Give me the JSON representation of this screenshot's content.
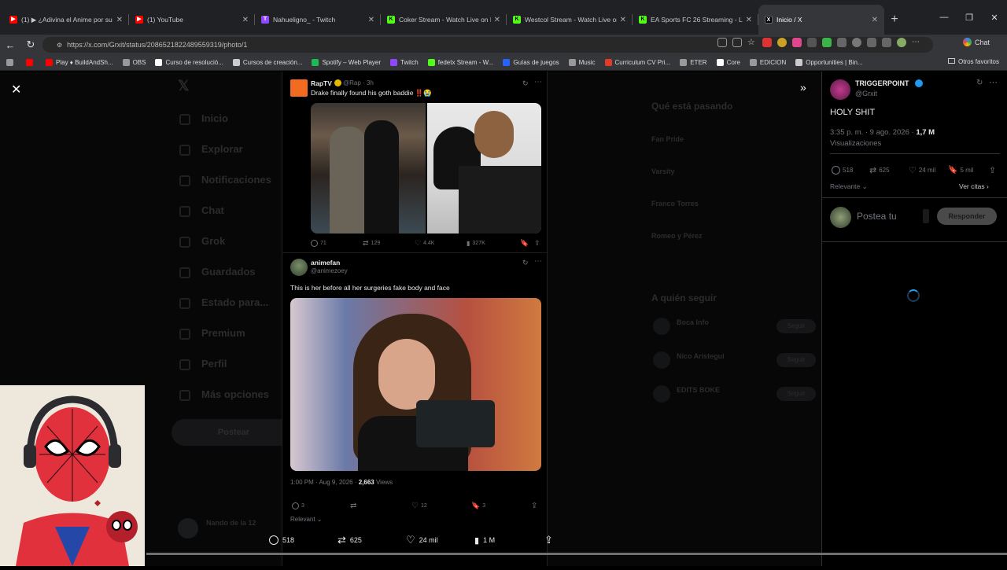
{
  "browser": {
    "tabs": [
      {
        "title": "(1) ▶ ¿Adivina el Anime por su Et",
        "fav": "▶",
        "color": "#ff0000"
      },
      {
        "title": "(1) YouTube",
        "fav": "▶",
        "color": "#ff0000"
      },
      {
        "title": "Nahueligno_ - Twitch",
        "fav": "T",
        "color": "#9146ff"
      },
      {
        "title": "Coker Stream - Watch Live on K",
        "fav": "K",
        "color": "#53fc18"
      },
      {
        "title": "Westcol Stream - Watch Live on K",
        "fav": "K",
        "color": "#53fc18"
      },
      {
        "title": "EA Sports FC 26 Streaming - Live S",
        "fav": "K",
        "color": "#53fc18"
      },
      {
        "title": "Inicio / X",
        "fav": "X",
        "color": "#000000"
      }
    ],
    "url": "https://x.com/Grxit/status/2086521822489559319/photo/1",
    "chat_label": "Chat",
    "bookmarks": [
      {
        "label": "",
        "color": "#999999"
      },
      {
        "label": "",
        "color": "#ff0000"
      },
      {
        "label": "Play ♦ BuildAndSh...",
        "color": "#ff0000"
      },
      {
        "label": "OBS",
        "color": "#999999"
      },
      {
        "label": "Curso de resolució...",
        "color": "#ffffff"
      },
      {
        "label": "Cursos de creación...",
        "color": "#cccccc"
      },
      {
        "label": "Spotify – Web Player",
        "color": "#1db954"
      },
      {
        "label": "Twitch",
        "color": "#9146ff"
      },
      {
        "label": "fedetx Stream - W...",
        "color": "#53fc18"
      },
      {
        "label": "Guías de juegos",
        "color": "#2962ff"
      },
      {
        "label": "Music",
        "color": "#999999"
      },
      {
        "label": "Curriculum CV Pri...",
        "color": "#e03b2b"
      },
      {
        "label": "ETER",
        "color": "#999999"
      },
      {
        "label": "Core",
        "color": "#ffffff"
      },
      {
        "label": "EDICION",
        "color": "#999999"
      },
      {
        "label": "Opportunities | Bin...",
        "color": "#cccccc"
      }
    ],
    "other_bookmarks": "Otros favoritos"
  },
  "background_nav": [
    "Inicio",
    "Explorar",
    "Notificaciones",
    "Chat",
    "Grok",
    "Guardados",
    "Estado para...",
    "Premium",
    "Perfil",
    "Más opciones"
  ],
  "background_post_button": "Postear",
  "background_right": {
    "heading": "Qué está pasando",
    "items": [
      "Fan Pride",
      "Varsity",
      "Franco Torres",
      "Romeo y Pérez"
    ],
    "who_to_follow": "A quién seguir",
    "follow": [
      "Boca Info",
      "Nico Arístegui",
      "EDITS BOKE"
    ],
    "follow_btn": "Seguir"
  },
  "background_user": "Nando de la 12",
  "post1": {
    "name": "RapTV",
    "handle": "@Rap · 3h",
    "text": "Drake finally found his goth baddie ‼️😭",
    "replies": "71",
    "reposts": "129",
    "likes": "4.4K",
    "views": "327K"
  },
  "post2": {
    "name": "animefan",
    "handle": "@animezoey",
    "text": "This is her before all her surgeries fake body and face",
    "time": "1:00 PM · Aug 9, 2026 · ",
    "views_count": "2,663",
    "views_label": " Views",
    "replies": "3",
    "likes": "12",
    "bookmarks": "3",
    "sort": "Relevant"
  },
  "main_post": {
    "name": "TRIGGERPOINT",
    "handle": "@Grxit",
    "text": "HOLY SHIT",
    "time": "3:35 p. m. · 9 ago. 2026 · ",
    "views": "1,7 M",
    "views_label": "Visualizaciones",
    "replies": "518",
    "reposts": "625",
    "likes": "24 mil",
    "bookmarks": "5 mil",
    "sort": "Relevante",
    "see_quotes": "Ver citas",
    "reply_placeholder": "Postea tu",
    "reply_button": "Responder"
  },
  "bottom_bar": {
    "replies": "518",
    "reposts": "625",
    "likes": "24 mil",
    "views": "1 M"
  }
}
